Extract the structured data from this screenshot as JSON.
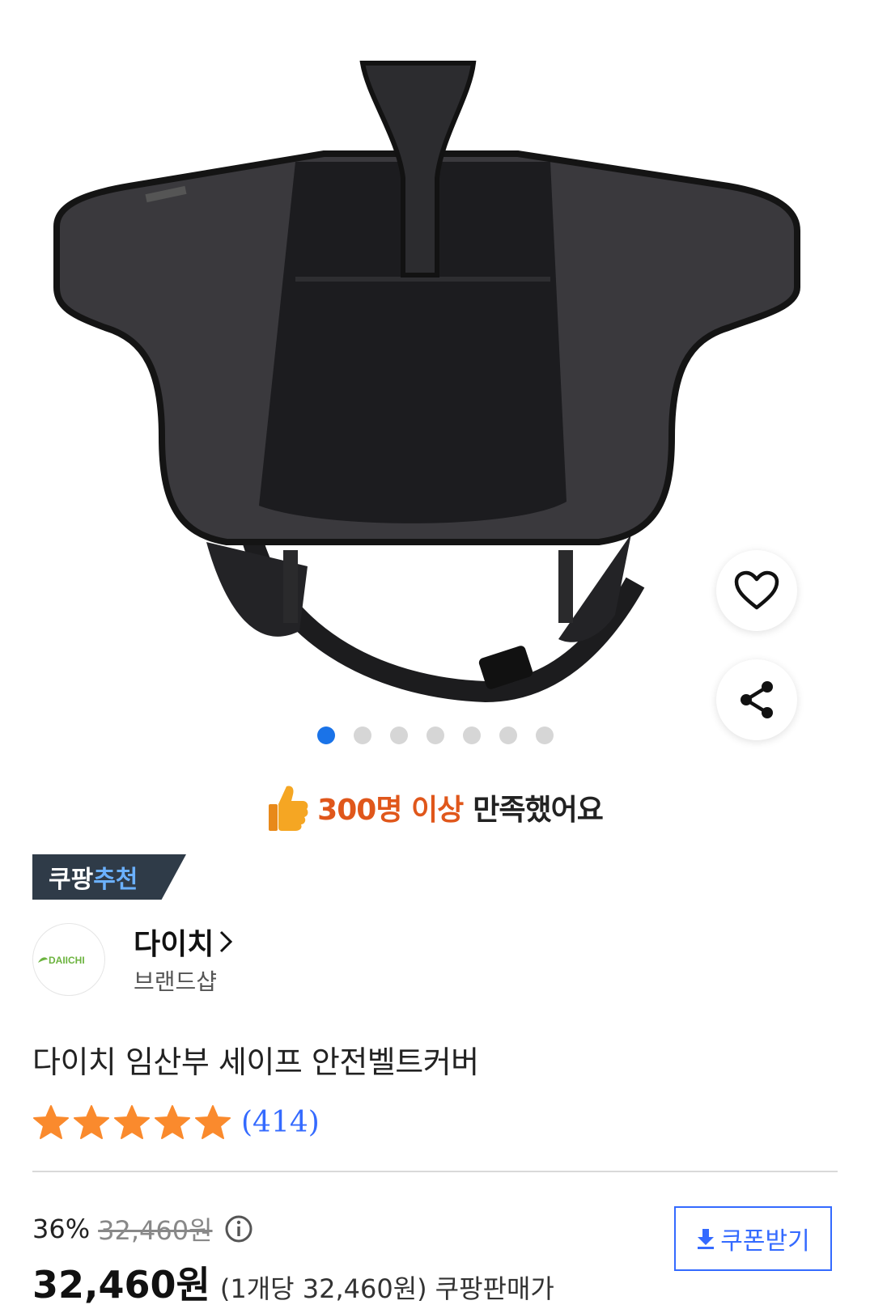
{
  "gallery": {
    "image_alt": "다이치 임산부 세이프 안전벨트커버",
    "dot_count": 7,
    "active_dot": 0
  },
  "satisfaction": {
    "highlight": "300명 이상",
    "rest": "만족했어요"
  },
  "badge": {
    "part1": "쿠팡",
    "part2": "추천"
  },
  "brand": {
    "logo_text": "DAIICHI",
    "name": "다이치",
    "sub": "브랜드샵"
  },
  "product": {
    "title": "다이치 임산부 세이프 안전벨트커버",
    "rating": 5,
    "review_count": "(414)"
  },
  "pricing": {
    "discount_pct": "36%",
    "original_price": "32,460원",
    "price": "32,460원",
    "unit_price": "(1개당 32,460원)",
    "seller": "쿠팡판매가",
    "coupon_label": "쿠폰받기"
  },
  "colors": {
    "accent_blue": "#346aff",
    "highlight_orange": "#e0571b",
    "star": "#fa8a2d"
  }
}
